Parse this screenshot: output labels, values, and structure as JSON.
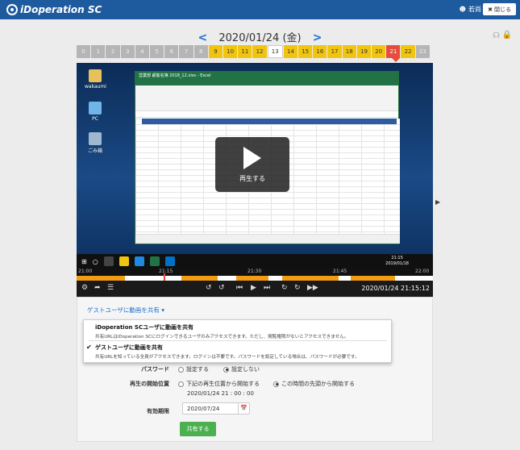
{
  "header": {
    "logo": "iDoperation SC",
    "user": "若尚",
    "close_label": "閉じる"
  },
  "date_nav": {
    "prev": "<",
    "date": "2020/01/24 (金)",
    "next": ">"
  },
  "hours": [
    {
      "label": "0",
      "state": "gray"
    },
    {
      "label": "1",
      "state": "gray"
    },
    {
      "label": "2",
      "state": "gray"
    },
    {
      "label": "3",
      "state": "gray"
    },
    {
      "label": "4",
      "state": "gray"
    },
    {
      "label": "5",
      "state": "gray"
    },
    {
      "label": "6",
      "state": "gray"
    },
    {
      "label": "7",
      "state": "gray"
    },
    {
      "label": "8",
      "state": "gray"
    },
    {
      "label": "9",
      "state": "yellow"
    },
    {
      "label": "10",
      "state": "yellow"
    },
    {
      "label": "11",
      "state": "yellow"
    },
    {
      "label": "12",
      "state": "yellow"
    },
    {
      "label": "13",
      "state": "white"
    },
    {
      "label": "14",
      "state": "yellow"
    },
    {
      "label": "15",
      "state": "yellow"
    },
    {
      "label": "16",
      "state": "yellow"
    },
    {
      "label": "17",
      "state": "yellow"
    },
    {
      "label": "18",
      "state": "yellow"
    },
    {
      "label": "19",
      "state": "yellow"
    },
    {
      "label": "20",
      "state": "yellow"
    },
    {
      "label": "21",
      "state": "red"
    },
    {
      "label": "22",
      "state": "yellow"
    },
    {
      "label": "23",
      "state": "gray"
    }
  ],
  "desktop": {
    "icons": [
      "wakaumi",
      "PC",
      "ごみ箱"
    ],
    "excel_title": "営業部 顧客名簿 2018_12.xlsx - Excel",
    "play_label": "再生する",
    "tray_time": "21:15",
    "tray_date": "2019/01/18"
  },
  "timeline": {
    "labels": [
      "21:00",
      "21:15",
      "21:30",
      "21:45",
      "22:00"
    ]
  },
  "player": {
    "timestamp": "2020/01/24 21:15:12"
  },
  "panel": {
    "share_dropdown": "ゲストユーザに動画を共有 ▾",
    "options": [
      {
        "title": "iDoperation SCユーザに動画を共有",
        "desc": "共有URLはiDoperation SCにログインできるユーザのみアクセスできます。ただし、閲覧権限がないとアクセスできません。",
        "checked": false
      },
      {
        "title": "ゲストユーザに動画を共有",
        "desc": "共有URLを知っている全員がアクセスできます。ログインは不要です。パスワードを設定している場合は、パスワードが必要です。",
        "checked": true
      }
    ],
    "password_label": "パスワード",
    "password_opt1": "設定する",
    "password_opt2": "設定しない",
    "start_label": "再生の開始位置",
    "start_opt1": "下記の再生位置から開始する",
    "start_opt2": "この時間の先頭から開始する",
    "start_time": "2020/01/24 21 : 00 : 00",
    "expiry_label": "有効期限",
    "expiry_value": "2020/07/24",
    "share_button": "共有する"
  }
}
